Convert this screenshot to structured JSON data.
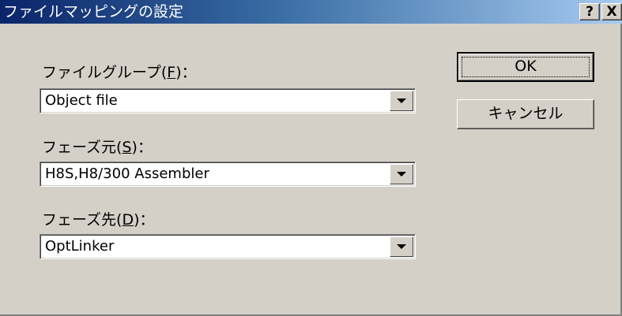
{
  "window": {
    "title": "ファイルマッピングの設定",
    "help_label": "?",
    "close_label": "X"
  },
  "fields": {
    "file_group": {
      "label_prefix": "ファイルグループ(",
      "accel": "F",
      "label_suffix": ")：",
      "value": "Object file"
    },
    "phase_from": {
      "label_prefix": "フェーズ元(",
      "accel": "S",
      "label_suffix": ")：",
      "value": "H8S,H8/300 Assembler"
    },
    "phase_to": {
      "label_prefix": "フェーズ先(",
      "accel": "D",
      "label_suffix": ")：",
      "value": "OptLinker"
    }
  },
  "buttons": {
    "ok": "OK",
    "cancel": "キャンセル"
  },
  "colors": {
    "title_gradient_start": "#0a246a",
    "title_gradient_end": "#a6caf0",
    "face": "#d4d0c8"
  },
  "icons": {
    "combo_arrow": "down-triangle"
  }
}
